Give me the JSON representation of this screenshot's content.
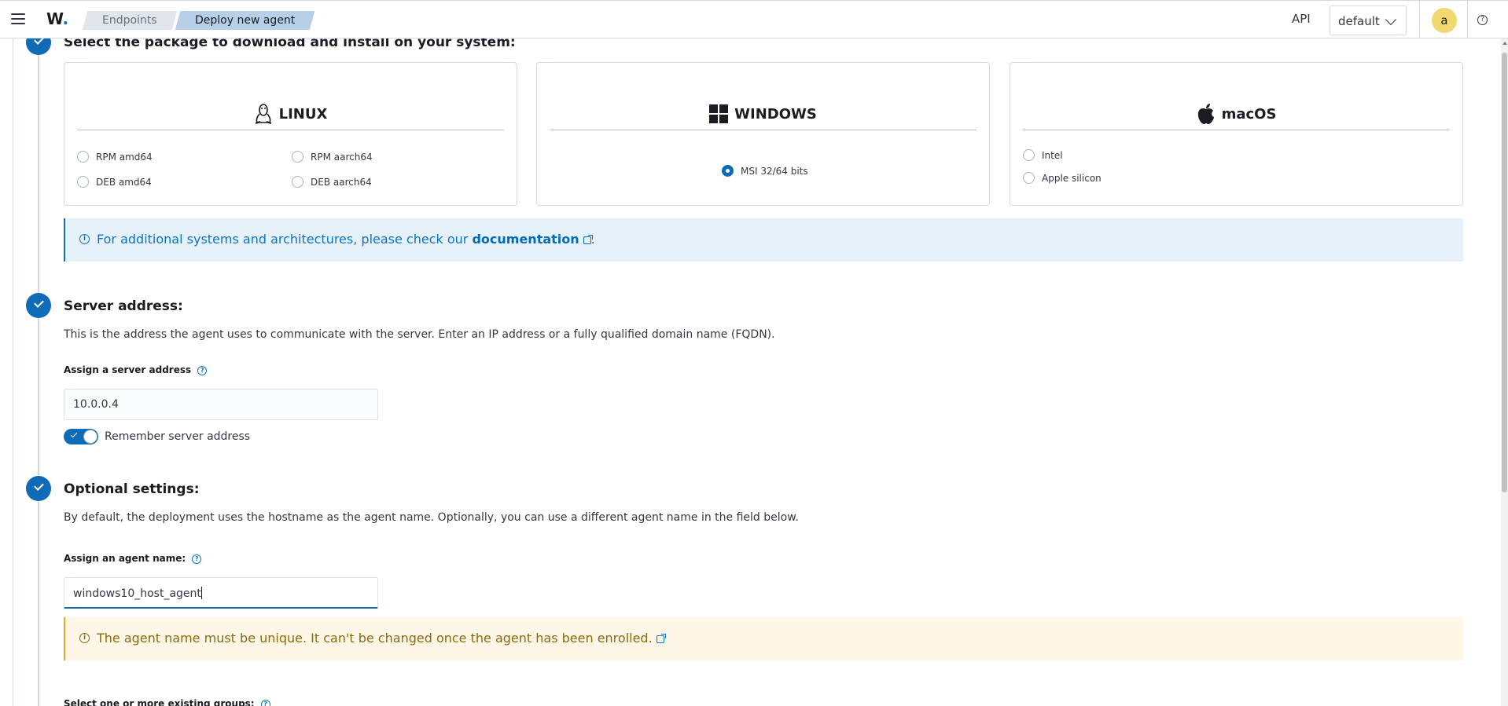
{
  "header": {
    "logo_text": "W",
    "logo_dot": ".",
    "breadcrumbs": [
      {
        "label": "Endpoints"
      },
      {
        "label": "Deploy new agent"
      }
    ],
    "api_label": "API",
    "space_selected": "default",
    "avatar_initial": "a",
    "help_glyph": "?"
  },
  "package_step": {
    "title": "Select the package to download and install on your system:",
    "os_cards": [
      {
        "name": "LINUX",
        "icon": "linux-tux-icon",
        "options": [
          "RPM amd64",
          "RPM aarch64",
          "DEB amd64",
          "DEB aarch64"
        ]
      },
      {
        "name": "WINDOWS",
        "icon": "windows-logo-icon",
        "options": [
          "MSI 32/64 bits"
        ],
        "selected": "MSI 32/64 bits"
      },
      {
        "name": "macOS",
        "icon": "apple-logo-icon",
        "options": [
          "Intel",
          "Apple silicon"
        ]
      }
    ],
    "info_callout": {
      "text_before": "For additional systems and architectures, please check our ",
      "link_text": "documentation",
      "text_after": "."
    }
  },
  "server_step": {
    "title": "Server address:",
    "description": "This is the address the agent uses to communicate with the server. Enter an IP address or a fully qualified domain name (FQDN).",
    "field_label": "Assign a server address",
    "value": "10.0.0.4",
    "remember_label": "Remember server address",
    "remember_on": true
  },
  "optional_step": {
    "title": "Optional settings:",
    "description": "By default, the deployment uses the hostname as the agent name. Optionally, you can use a different agent name in the field below.",
    "agent_name_label": "Assign an agent name:",
    "agent_name_value": "windows10_host_agent",
    "warning_text": "The agent name must be unique. It can't be changed once the agent has been enrolled.",
    "groups_label": "Select one or more existing groups:"
  },
  "colors": {
    "primary": "#0f6bb7",
    "info_bg": "#e6f1fa",
    "warning_bg": "#fef6e6",
    "avatar": "#f1d86f"
  }
}
